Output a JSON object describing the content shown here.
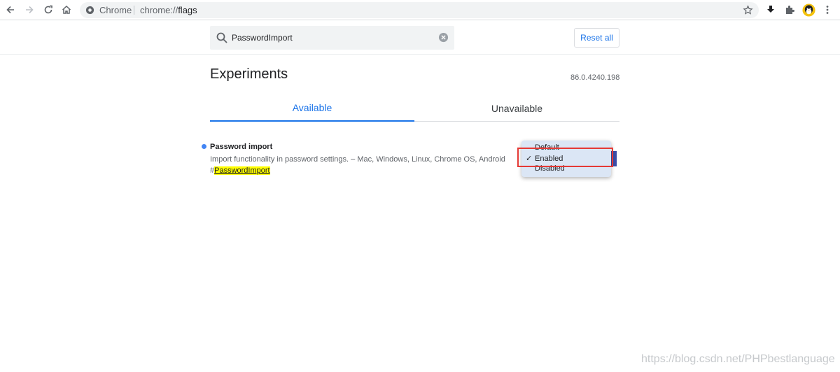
{
  "browser": {
    "site_chip": "Chrome",
    "url_prefix": "chrome://",
    "url_host": "flags"
  },
  "flags": {
    "search_value": "PasswordImport",
    "reset_label": "Reset all",
    "title": "Experiments",
    "version": "86.0.4240.198",
    "tabs": [
      {
        "label": "Available"
      },
      {
        "label": "Unavailable"
      }
    ],
    "experiment": {
      "name": "Password import",
      "description": "Import functionality in password settings. – Mac, Windows, Linux, Chrome OS, Android",
      "hash": "#",
      "link": "PasswordImport"
    },
    "dropdown": {
      "options": [
        "Default",
        "Enabled",
        "Disabled"
      ],
      "selected": "Enabled",
      "check": "✓"
    }
  },
  "watermark": "https://blog.csdn.net/PHPbestlanguage",
  "colors": {
    "accent": "#1a73e8",
    "dot": "#4285f4",
    "highlight": "#ffff00",
    "annotation": "#e53935"
  }
}
